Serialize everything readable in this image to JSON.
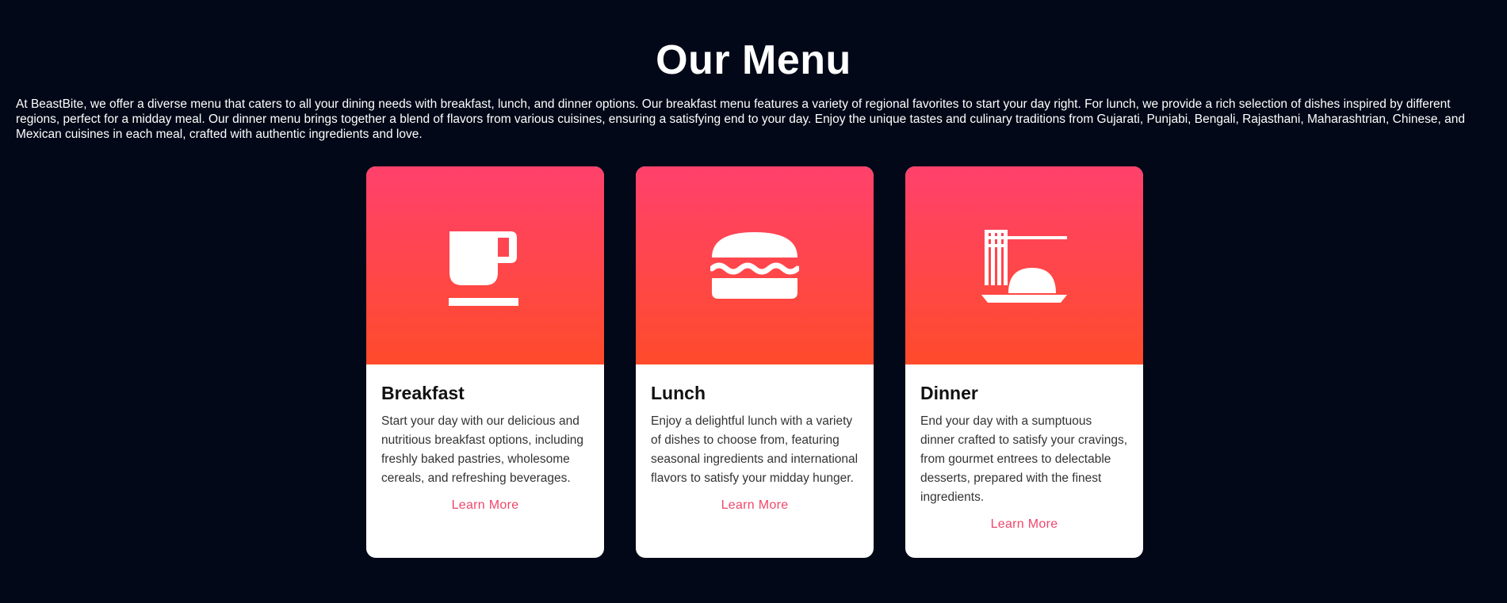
{
  "section": {
    "title": "Our Menu",
    "intro": "At BeastBite, we offer a diverse menu that caters to all your dining needs with breakfast, lunch, and dinner options. Our breakfast menu features a variety of regional favorites to start your day right. For lunch, we provide a rich selection of dishes inspired by different regions, perfect for a midday meal. Our dinner menu brings together a blend of flavors from various cuisines, ensuring a satisfying end to your day. Enjoy the unique tastes and culinary traditions from Gujarati, Punjabi, Bengali, Rajasthani, Maharashtrian, Chinese, and Mexican cuisines in each meal, crafted with authentic ingredients and love."
  },
  "colors": {
    "background": "#020817",
    "gradient_top": "#ff416c",
    "gradient_bottom": "#ff4b2b",
    "link": "#f0466b"
  },
  "cards": [
    {
      "icon": "coffee-cup-icon",
      "title": "Breakfast",
      "description": "Start your day with our delicious and nutritious breakfast options, including freshly baked pastries, wholesome cereals, and refreshing beverages.",
      "link_label": "Learn More"
    },
    {
      "icon": "burger-icon",
      "title": "Lunch",
      "description": "Enjoy a delightful lunch with a variety of dishes to choose from, featuring seasonal ingredients and international flavors to satisfy your midday hunger.",
      "link_label": "Learn More"
    },
    {
      "icon": "noodle-bowl-icon",
      "title": "Dinner",
      "description": "End your day with a sumptuous dinner crafted to satisfy your cravings, from gourmet entrees to delectable desserts, prepared with the finest ingredients.",
      "link_label": "Learn More"
    }
  ]
}
